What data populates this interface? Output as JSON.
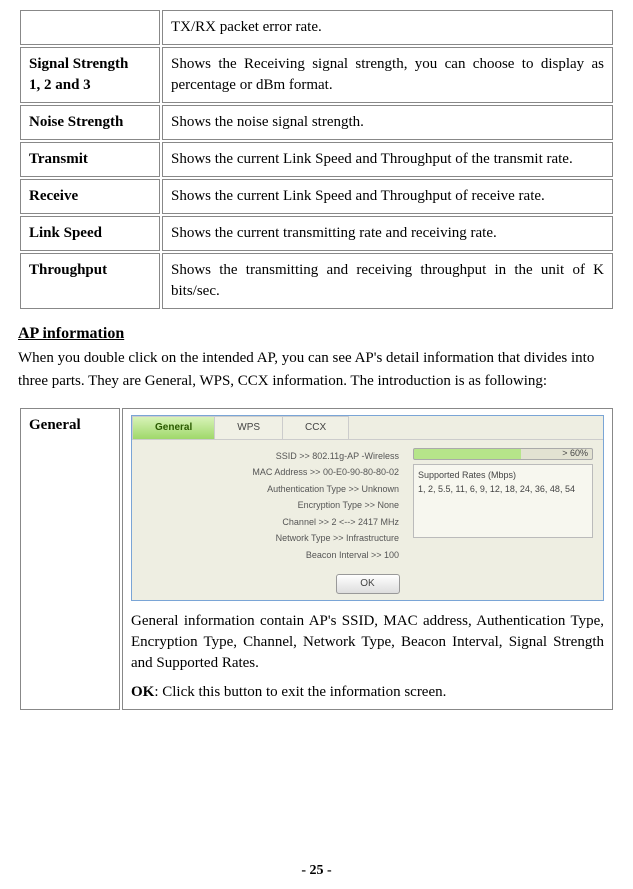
{
  "defs": [
    {
      "label": "",
      "desc": "TX/RX packet error rate."
    },
    {
      "label": "Signal Strength\n1, 2 and 3",
      "desc": "Shows the Receiving signal strength, you can choose to display as percentage or dBm format."
    },
    {
      "label": "Noise Strength",
      "desc": "Shows the noise signal strength."
    },
    {
      "label": "Transmit",
      "desc": "Shows the current Link Speed and Throughput of the transmit rate."
    },
    {
      "label": "Receive",
      "desc": "Shows the current Link Speed and Throughput of receive rate."
    },
    {
      "label": "Link Speed",
      "desc": "Shows the current transmitting rate and receiving rate."
    },
    {
      "label": "Throughput",
      "desc": "Shows the transmitting and receiving throughput in the unit of K bits/sec."
    }
  ],
  "section_title": "AP information",
  "section_intro": "When you double click on the intended AP, you can see AP's detail information that divides into three parts. They are General, WPS, CCX information. The introduction is as following:",
  "general_label": "General",
  "tabs": {
    "general": "General",
    "wps": "WPS",
    "ccx": "CCX"
  },
  "shot": {
    "ssid": "SSID >>  802.11g-AP -Wireless",
    "mac": "MAC Address >>  00-E0-90-80-80-02",
    "auth": "Authentication Type >>  Unknown",
    "enc": "Encryption Type >>  None",
    "chan": "Channel >>  2  <-->  2417 MHz",
    "ntype": "Network Type >>  Infrastructure",
    "beacon": "Beacon Interval >>  100",
    "sig_pct": "> 60%",
    "rates_label": "Supported Rates (Mbps)",
    "rates": "1, 2, 5.5, 11, 6, 9, 12, 18, 24, 36, 48, 54",
    "ok": "OK"
  },
  "general_desc": "General information contain AP's SSID, MAC address, Authentication Type, Encryption Type, Channel, Network Type, Beacon Interval, Signal Strength and Supported Rates.",
  "ok_bold": "OK",
  "ok_desc": ": Click this button to exit the information screen.",
  "page_num": "- 25 -"
}
